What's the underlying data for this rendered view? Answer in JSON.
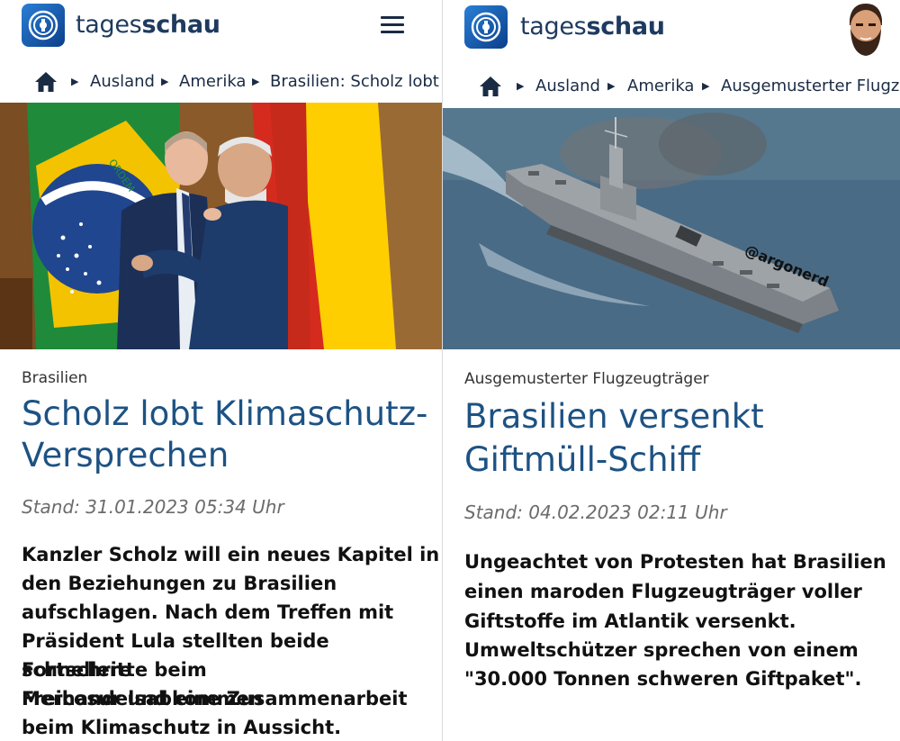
{
  "left": {
    "brand": {
      "part1": "tages",
      "part2": "schau"
    },
    "breadcrumb": [
      "Ausland",
      "Amerika",
      "Brasilien: Scholz lobt Kli"
    ],
    "kicker": "Brasilien",
    "headline_line1": "Scholz lobt Klimaschutz-",
    "headline_line2": "Versprechen",
    "timestamp": "Stand: 31.01.2023 05:34 Uhr",
    "lead_lines": [
      "Kanzler Scholz will ein neues Kapitel in",
      "den Beziehungen zu Brasilien",
      "aufschlagen. Nach dem Treffen mit",
      "Präsident Lula stellten beide schnellere",
      "Fortschritte beim Freihandelsabkommen",
      "Mercosur und eine Zusammenarbeit",
      "beim Klimaschutz in Aussicht."
    ],
    "flag_text": "ORDEM"
  },
  "right": {
    "brand": {
      "part1": "tages",
      "part2": "schau"
    },
    "breadcrumb": [
      "Ausland",
      "Amerika",
      "Ausgemusterter Flugzeu"
    ],
    "kicker": "Ausgemusterter Flugzeugträger",
    "headline_line1": "Brasilien versenkt",
    "headline_line2": "Giftmüll-Schiff",
    "timestamp": "Stand: 04.02.2023 02:11 Uhr",
    "lead_lines": [
      "Ungeachtet von Protesten hat Brasilien",
      "einen maroden Flugzeugträger voller",
      "Giftstoffe im Atlantik versenkt.",
      "Umweltschützer sprechen von einem",
      "\"30.000 Tonnen schweren Giftpaket\"."
    ],
    "watermark": "@argonerd"
  },
  "icons": {
    "logo": "tagesschau-logo-icon",
    "menu": "hamburger-menu-icon",
    "home": "home-icon",
    "breadcrumb_separator": "triangle-right-icon",
    "avatar": "bearded-avatar-icon"
  },
  "colors": {
    "brand_text": "#1e3a5f",
    "headline": "#1d5283",
    "logo_blue": "#1f6fc4"
  }
}
